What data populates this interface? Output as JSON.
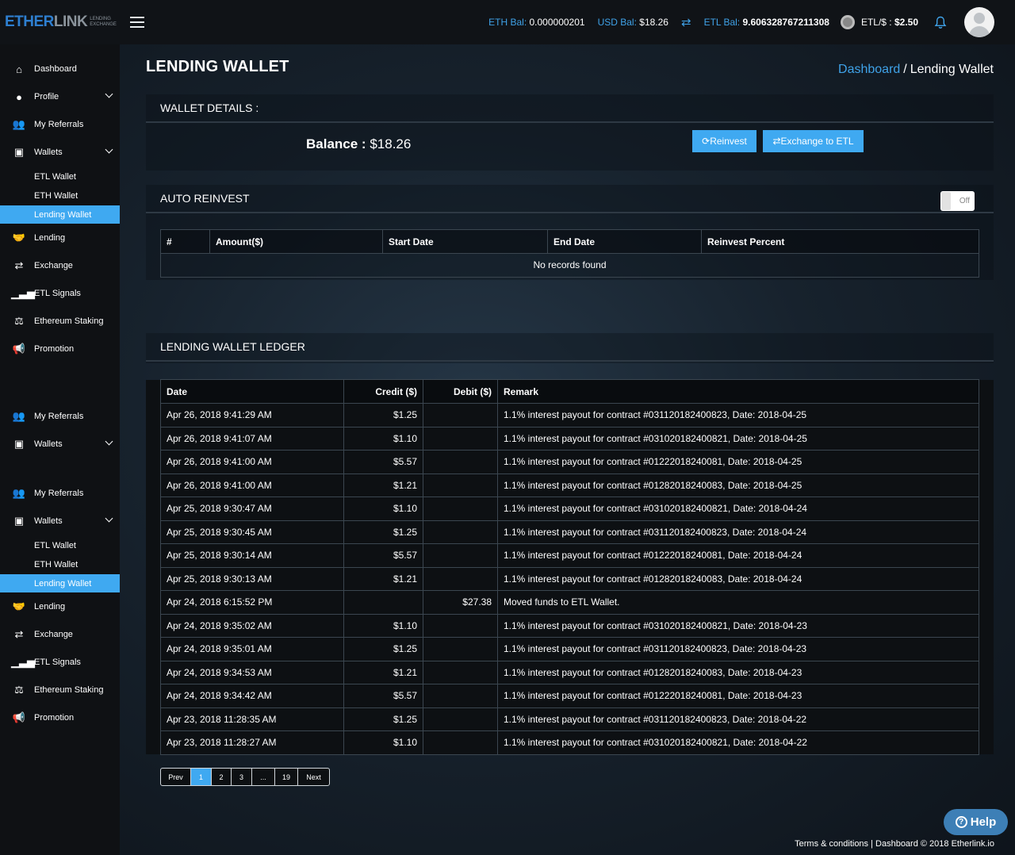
{
  "brand": {
    "name_part1": "ETHER",
    "name_part2": "LINK",
    "sub1": "LENDING",
    "sub2": "EXCHANGE"
  },
  "header": {
    "eth_bal_label": "ETH Bal:",
    "eth_bal_value": "0.000000201",
    "usd_bal_label": "USD Bal:",
    "usd_bal_value": "$18.26",
    "etl_bal_label": "ETL Bal:",
    "etl_bal_value": "9.606328767211308",
    "etl_rate_label": "ETL/$ :",
    "etl_rate_value": "$2.50"
  },
  "sidebar": {
    "dashboard": "Dashboard",
    "profile": "Profile",
    "my_referrals": "My Referrals",
    "wallets": "Wallets",
    "etl_wallet": "ETL Wallet",
    "eth_wallet": "ETH Wallet",
    "lending_wallet": "Lending Wallet",
    "lending": "Lending",
    "exchange": "Exchange",
    "etl_signals": "ETL Signals",
    "ethereum_staking": "Ethereum Staking",
    "promotion": "Promotion"
  },
  "page": {
    "title": "LENDING WALLET",
    "breadcrumb_link": "Dashboard",
    "breadcrumb_sep": "/",
    "breadcrumb_current": "Lending Wallet"
  },
  "wallet_details": {
    "heading": "WALLET DETAILS :",
    "balance_label": "Balance :",
    "balance_value": "$18.26",
    "reinvest_label": "Reinvest",
    "exchange_label": "Exchange to ETL"
  },
  "auto_reinvest": {
    "heading": "AUTO REINVEST",
    "toggle_label": "Off",
    "columns": [
      "#",
      "Amount($)",
      "Start Date",
      "End Date",
      "Reinvest Percent"
    ],
    "empty": "No records found"
  },
  "ledger": {
    "heading": "LENDING WALLET LEDGER",
    "columns": {
      "date": "Date",
      "credit": "Credit ($)",
      "debit": "Debit ($)",
      "remark": "Remark"
    },
    "rows": [
      {
        "date": "Apr 26, 2018 9:41:29 AM",
        "credit": "$1.25",
        "debit": "",
        "remark": "1.1% interest payout for contract #031120182400823, Date: 2018-04-25"
      },
      {
        "date": "Apr 26, 2018 9:41:07 AM",
        "credit": "$1.10",
        "debit": "",
        "remark": "1.1% interest payout for contract #031020182400821, Date: 2018-04-25"
      },
      {
        "date": "Apr 26, 2018 9:41:00 AM",
        "credit": "$5.57",
        "debit": "",
        "remark": "1.1% interest payout for contract #01222018240081, Date: 2018-04-25"
      },
      {
        "date": "Apr 26, 2018 9:41:00 AM",
        "credit": "$1.21",
        "debit": "",
        "remark": "1.1% interest payout for contract #01282018240083, Date: 2018-04-25"
      },
      {
        "date": "Apr 25, 2018 9:30:47 AM",
        "credit": "$1.10",
        "debit": "",
        "remark": "1.1% interest payout for contract #031020182400821, Date: 2018-04-24"
      },
      {
        "date": "Apr 25, 2018 9:30:45 AM",
        "credit": "$1.25",
        "debit": "",
        "remark": "1.1% interest payout for contract #031120182400823, Date: 2018-04-24"
      },
      {
        "date": "Apr 25, 2018 9:30:14 AM",
        "credit": "$5.57",
        "debit": "",
        "remark": "1.1% interest payout for contract #01222018240081, Date: 2018-04-24"
      },
      {
        "date": "Apr 25, 2018 9:30:13 AM",
        "credit": "$1.21",
        "debit": "",
        "remark": "1.1% interest payout for contract #01282018240083, Date: 2018-04-24"
      },
      {
        "date": "Apr 24, 2018 6:15:52 PM",
        "credit": "",
        "debit": "$27.38",
        "remark": "Moved funds to ETL Wallet."
      },
      {
        "date": "Apr 24, 2018 9:35:02 AM",
        "credit": "$1.10",
        "debit": "",
        "remark": "1.1% interest payout for contract #031020182400821, Date: 2018-04-23"
      },
      {
        "date": "Apr 24, 2018 9:35:01 AM",
        "credit": "$1.25",
        "debit": "",
        "remark": "1.1% interest payout for contract #031120182400823, Date: 2018-04-23"
      },
      {
        "date": "Apr 24, 2018 9:34:53 AM",
        "credit": "$1.21",
        "debit": "",
        "remark": "1.1% interest payout for contract #01282018240083, Date: 2018-04-23"
      },
      {
        "date": "Apr 24, 2018 9:34:42 AM",
        "credit": "$5.57",
        "debit": "",
        "remark": "1.1% interest payout for contract #01222018240081, Date: 2018-04-23"
      },
      {
        "date": "Apr 23, 2018 11:28:35 AM",
        "credit": "$1.25",
        "debit": "",
        "remark": "1.1% interest payout for contract #031120182400823, Date: 2018-04-22"
      },
      {
        "date": "Apr 23, 2018 11:28:27 AM",
        "credit": "$1.10",
        "debit": "",
        "remark": "1.1% interest payout for contract #031020182400821, Date: 2018-04-22"
      }
    ]
  },
  "pagination": {
    "prev": "Prev",
    "p1": "1",
    "p2": "2",
    "p3": "3",
    "ellipsis": "...",
    "last": "19",
    "next": "Next"
  },
  "help": {
    "label": "Help"
  },
  "footer": {
    "text": "Terms & conditions | Dashboard © 2018  Etherlink.io"
  }
}
